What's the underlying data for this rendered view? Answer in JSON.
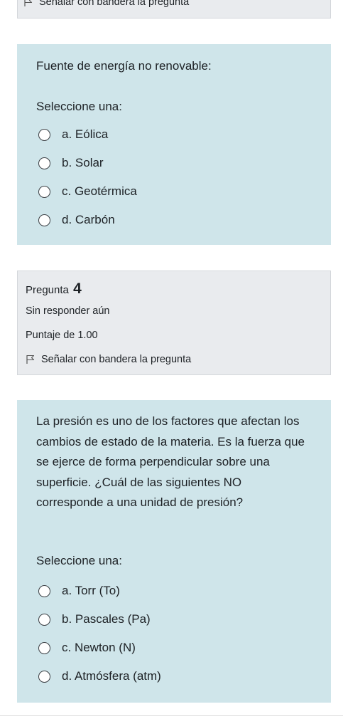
{
  "top_flag": {
    "label": "Señalar con bandera la pregunta"
  },
  "question3": {
    "text": "Fuente de energía no renovable:",
    "prompt": "Seleccione una:",
    "answers": [
      {
        "label": "a. Eólica"
      },
      {
        "label": "b. Solar"
      },
      {
        "label": "c. Geotérmica"
      },
      {
        "label": "d. Carbón"
      }
    ]
  },
  "question4": {
    "title_label": "Pregunta",
    "number": "4",
    "status": "Sin responder aún",
    "grade": "Puntaje de 1.00",
    "flag_label": "Señalar con bandera la pregunta",
    "text": "La presión es uno de los factores que afectan los cambios de estado de la materia. Es la fuerza que se ejerce de forma perpendicular sobre una superficie. ¿Cuál de las siguientes NO corresponde a una unidad de presión?",
    "prompt": "Seleccione una:",
    "answers": [
      {
        "label": "a. Torr (To)"
      },
      {
        "label": "b. Pascales (Pa)"
      },
      {
        "label": "c. Newton (N)"
      },
      {
        "label": "d. Atmósfera (atm)"
      }
    ]
  }
}
